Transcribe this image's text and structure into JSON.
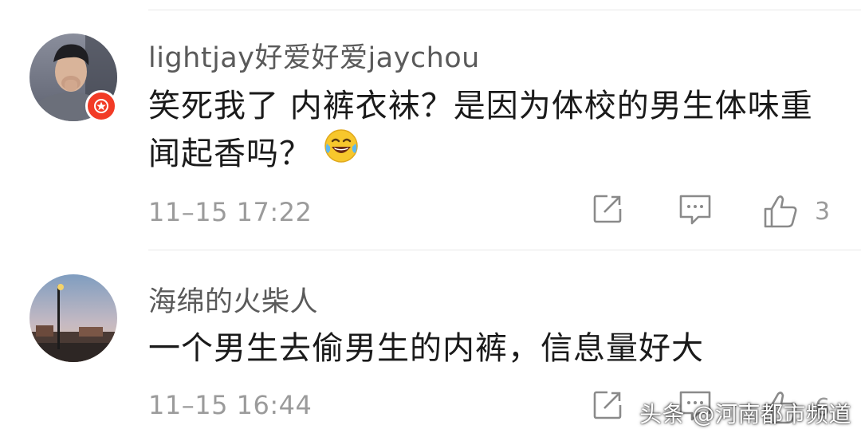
{
  "comments": [
    {
      "username": "lightjay好爱好爱jaychou",
      "text": "笑死我了 内裤衣袜？是因为体校的男生体味重 闻起香吗？",
      "emoji": "laughing-tears-emoji",
      "timestamp": "11–15 17:22",
      "like_count": "3",
      "badge_color": "#f23b26"
    },
    {
      "username": "海绵的火柴人",
      "text": "一个男生去偷男生的内裤，信息量好大",
      "timestamp": "11–15 16:44",
      "like_count": "6"
    }
  ],
  "icons": {
    "share": "share-icon",
    "comment": "comment-icon",
    "like": "thumbs-up-icon"
  },
  "watermark": "头条 @河南都市频道",
  "colors": {
    "username": "#5a5a5a",
    "text": "#1a1a1a",
    "meta": "#9b9b9b",
    "badge": "#f23b26"
  }
}
